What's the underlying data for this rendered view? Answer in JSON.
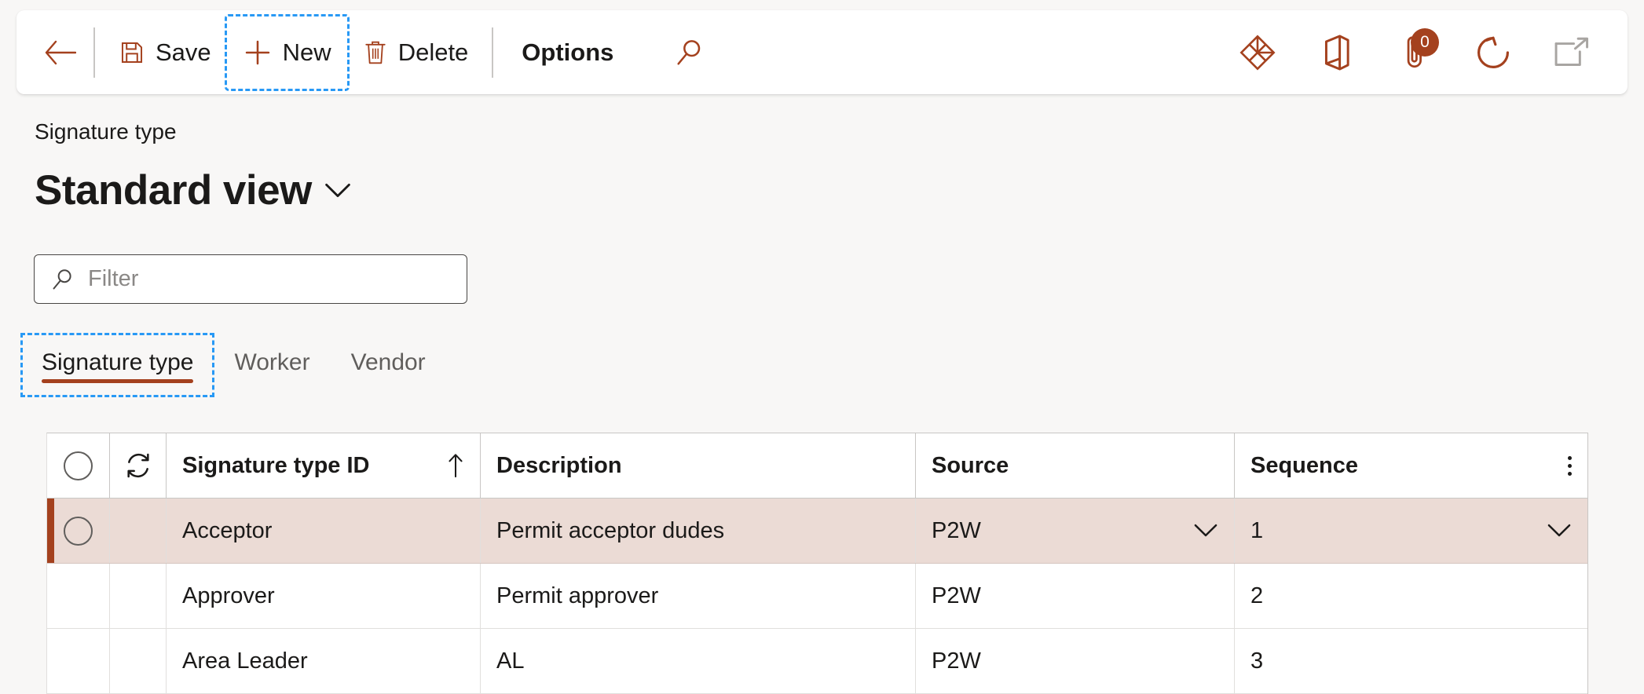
{
  "theme": {
    "accent": "#a4411e",
    "page_bg": "#f8f7f6",
    "selected_row_bg": "#ebdbd5",
    "focus_outline": "#2899f5"
  },
  "toolbar": {
    "back_icon": "back-arrow-icon",
    "save_label": "Save",
    "save_icon": "save-disk-icon",
    "new_label": "New",
    "new_icon": "plus-icon",
    "delete_label": "Delete",
    "delete_icon": "trash-icon",
    "options_label": "Options",
    "search_icon": "search-icon",
    "right_icons": [
      {
        "name": "powerbi-diamond-icon",
        "label": ""
      },
      {
        "name": "office-app-icon",
        "label": ""
      },
      {
        "name": "attachment-paperclip-icon",
        "label": "",
        "badge": "0"
      },
      {
        "name": "refresh-icon",
        "label": ""
      },
      {
        "name": "open-in-new-window-icon",
        "label": ""
      }
    ]
  },
  "header": {
    "breadcrumb": "Signature type",
    "page_title": "Standard view",
    "title_chevron": "chevron-down-icon"
  },
  "filter": {
    "icon": "search-icon",
    "placeholder": "Filter",
    "value": ""
  },
  "tabs": [
    {
      "label": "Signature type",
      "selected": true,
      "focused": true
    },
    {
      "label": "Worker",
      "selected": false,
      "focused": false
    },
    {
      "label": "Vendor",
      "selected": false,
      "focused": false
    }
  ],
  "grid": {
    "select_all_icon": "circle-select-all-icon",
    "refresh_column_icon": "refresh-sync-icon",
    "context_menu_icon": "more-options-vertical-icon",
    "columns": [
      {
        "key": "id",
        "label": "Signature type ID",
        "sort": "ascending",
        "sort_icon": "sort-ascending-arrow-icon"
      },
      {
        "key": "description",
        "label": "Description"
      },
      {
        "key": "source",
        "label": "Source"
      },
      {
        "key": "sequence",
        "label": "Sequence"
      }
    ],
    "rows": [
      {
        "id": "Acceptor",
        "description": "Permit acceptor dudes",
        "source": "P2W",
        "sequence": "1",
        "selected": true,
        "has_dropdowns": true
      },
      {
        "id": "Approver",
        "description": "Permit approver",
        "source": "P2W",
        "sequence": "2",
        "selected": false,
        "has_dropdowns": false
      },
      {
        "id": "Area Leader",
        "description": "AL",
        "source": "P2W",
        "sequence": "3",
        "selected": false,
        "has_dropdowns": false
      }
    ]
  }
}
